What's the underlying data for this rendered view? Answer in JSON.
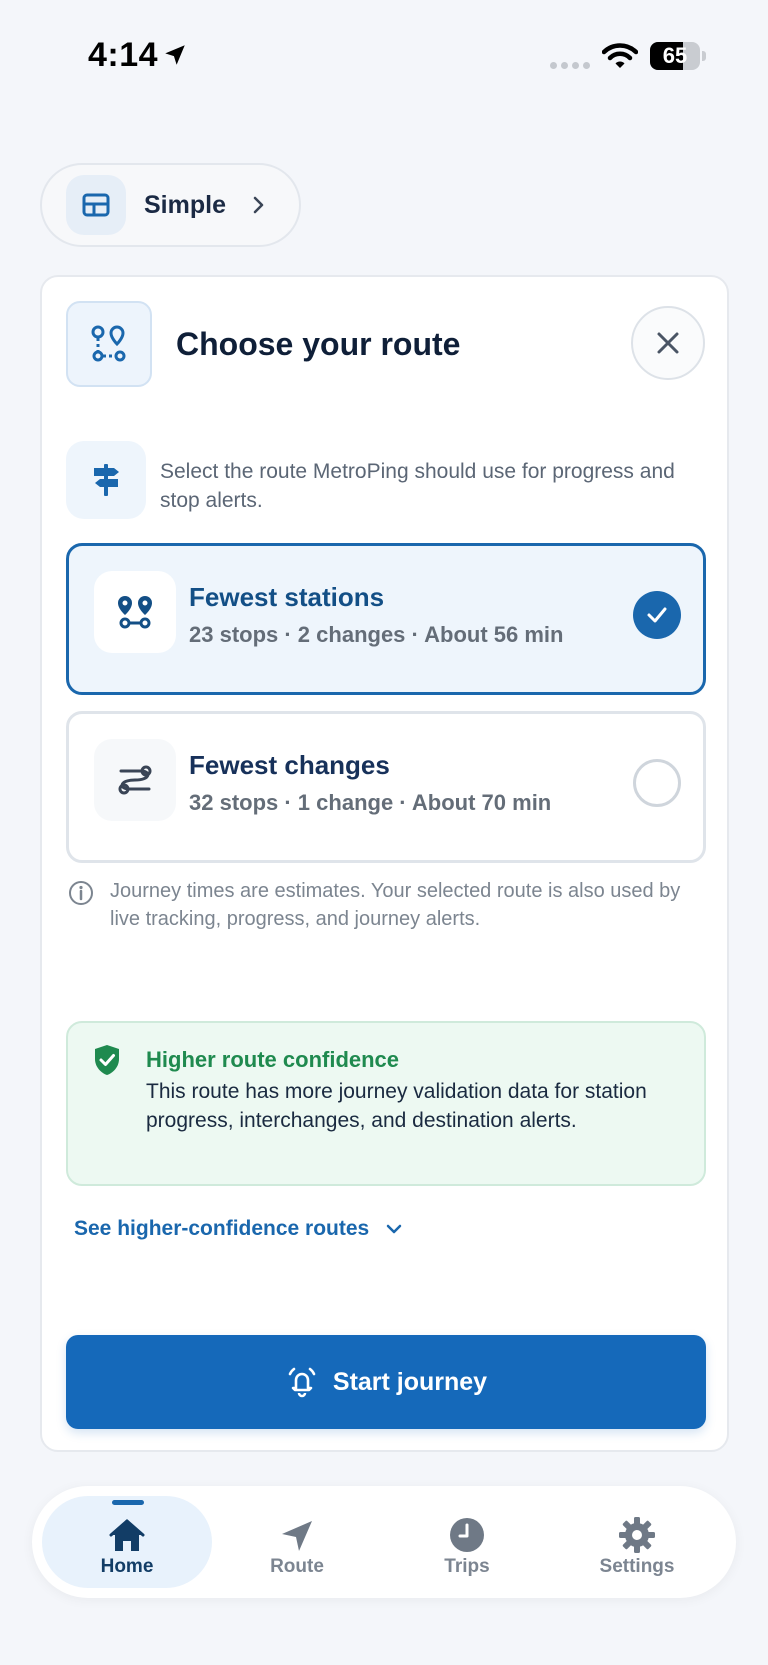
{
  "status_bar": {
    "time": "4:14",
    "battery_level": "65",
    "battery_fraction": 0.65
  },
  "mode_pill": {
    "label": "Simple",
    "icon": "layout-icon"
  },
  "route_card": {
    "title": "Choose your route",
    "hint": "Select the route MetroPing should use for progress and stop alerts.",
    "options": [
      {
        "title": "Fewest stations",
        "subtitle": "23 stops · 2 changes · About 56 min",
        "selected": true
      },
      {
        "title": "Fewest changes",
        "subtitle": "32 stops · 1 change · About 70 min",
        "selected": false
      }
    ],
    "info_note": "Journey times are estimates. Your selected route is also used by live tracking, progress, and journey alerts.",
    "confidence": {
      "title": "Higher route confidence",
      "text": "This route has more journey validation data for station progress, interchanges, and destination alerts."
    },
    "see_more_label": "See higher-confidence routes",
    "start_button_label": "Start journey"
  },
  "bottom_nav": {
    "items": [
      {
        "label": "Home",
        "icon": "home-icon",
        "active": true
      },
      {
        "label": "Route",
        "icon": "navigation-arrow-icon",
        "active": false
      },
      {
        "label": "Trips",
        "icon": "clock-icon",
        "active": false
      },
      {
        "label": "Settings",
        "icon": "gear-icon",
        "active": false
      }
    ]
  },
  "colors": {
    "primary": "#1569ba",
    "selected_border": "#1a67ad",
    "success": "#1f8a4f",
    "background": "#f4f6fa"
  }
}
